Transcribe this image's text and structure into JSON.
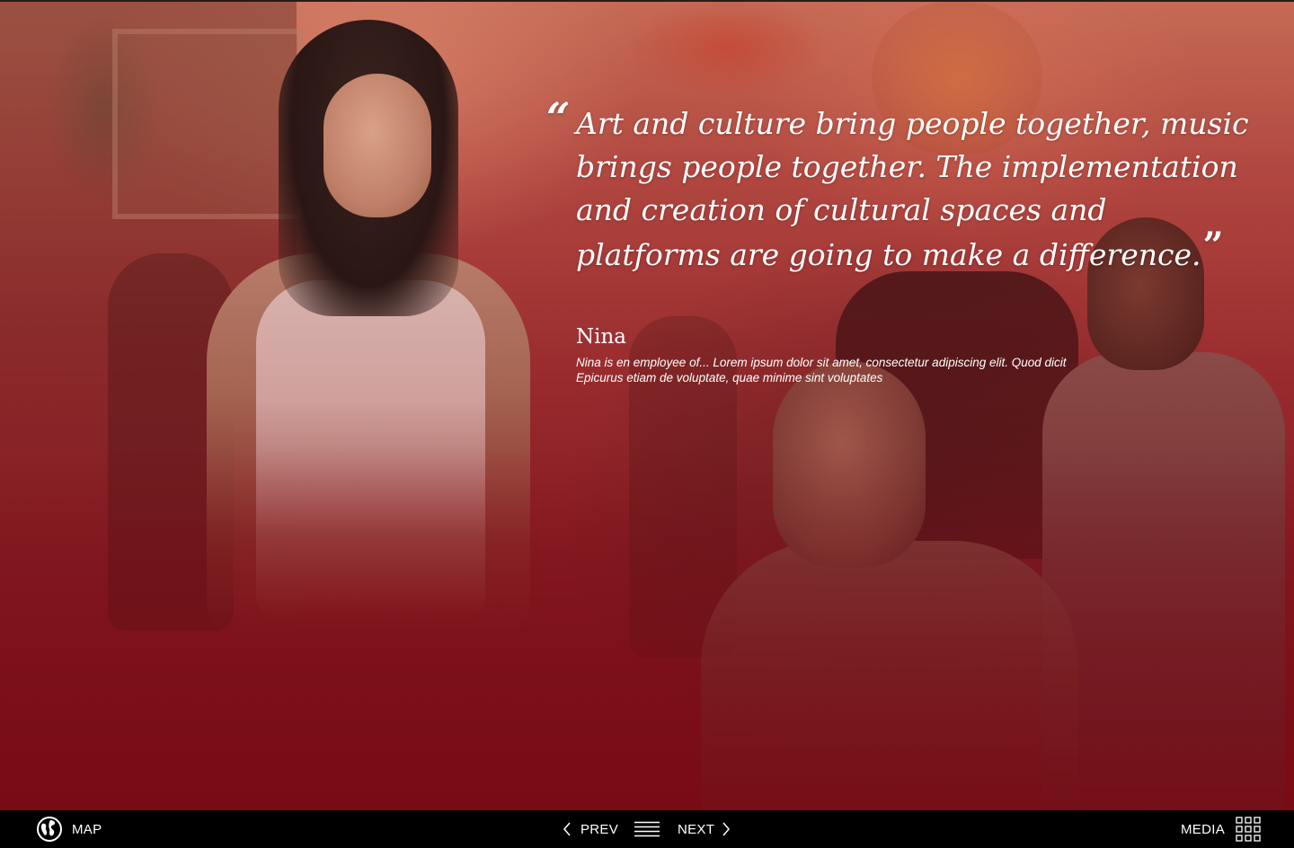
{
  "quote": {
    "text": "Art and culture bring people together, music brings people together. The implementation and creation of cultural spaces and platforms are going to make a difference.",
    "open_mark": "“",
    "close_mark": "”"
  },
  "person": {
    "name": "Nina",
    "bio": "Nina is en employee of... Lorem ipsum dolor sit amet, consectetur adipiscing elit. Quod dicit Epicurus etiam de voluptate, quae minime sint voluptates"
  },
  "nav": {
    "map_label": "MAP",
    "prev_label": "PREV",
    "next_label": "NEXT",
    "media_label": "MEDIA"
  },
  "icons": {
    "map": "globe-icon",
    "prev": "chevron-left-icon",
    "menu": "menu-icon",
    "next": "chevron-right-icon",
    "media": "grid-icon"
  },
  "colors": {
    "overlay_top": "#c56a55",
    "overlay_bottom": "#7a1119",
    "bar_background": "#000000",
    "text": "#ffffff"
  }
}
